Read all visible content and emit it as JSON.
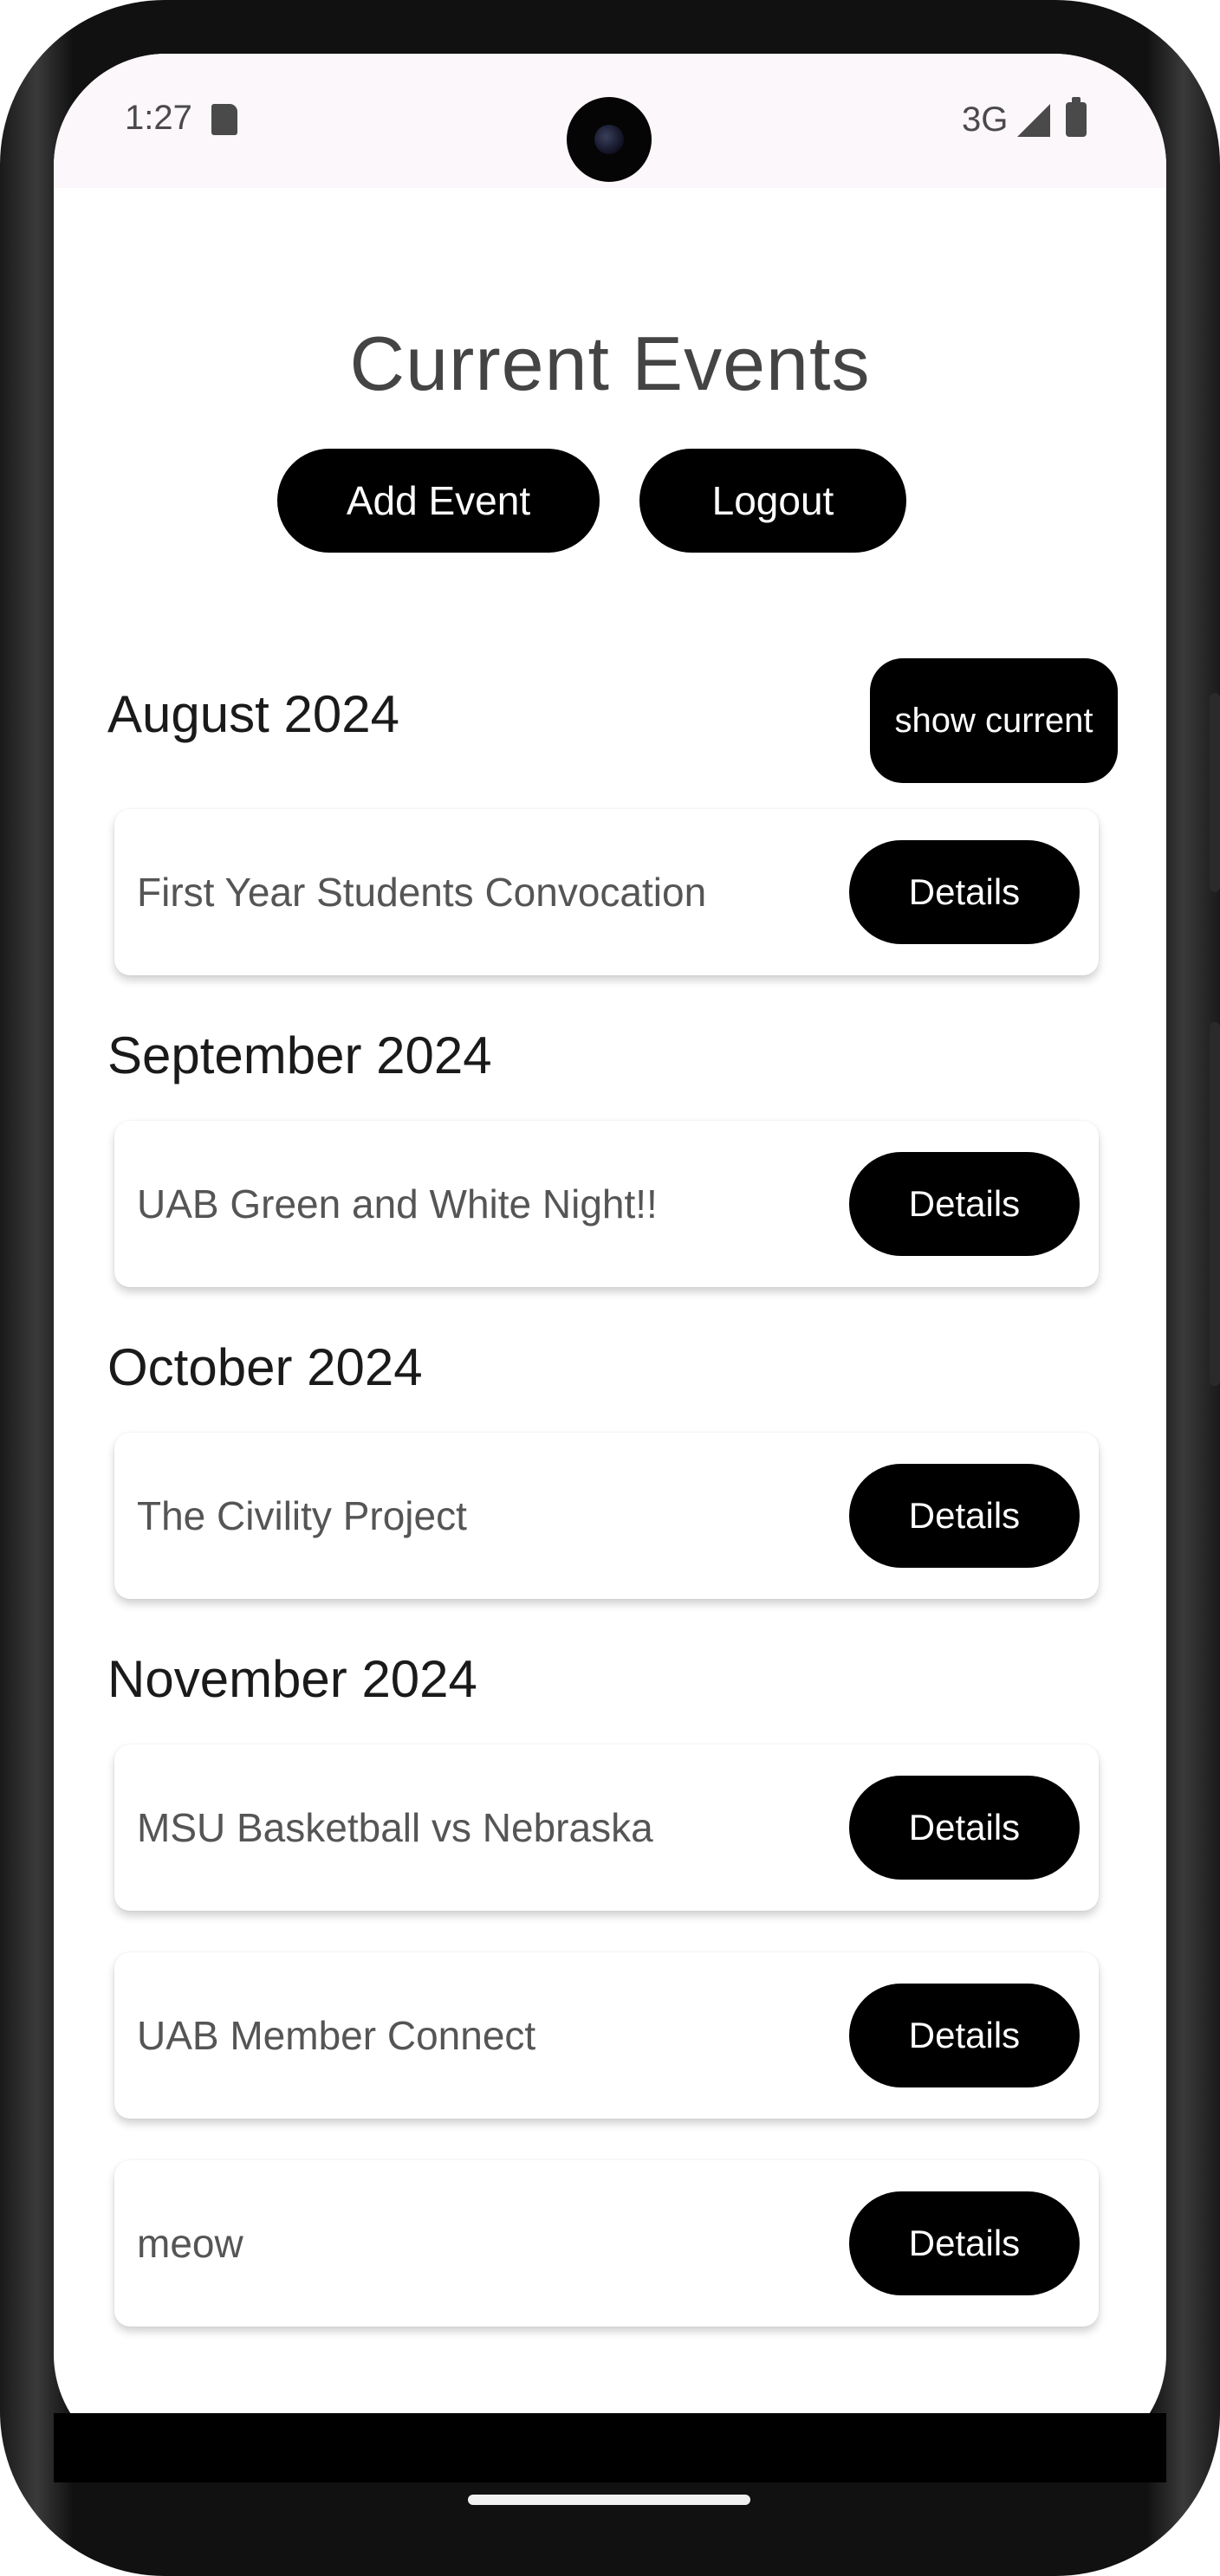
{
  "status_bar": {
    "time": "1:27",
    "network": "3G",
    "icons": [
      "sd-card-icon",
      "signal-icon",
      "battery-icon"
    ]
  },
  "header": {
    "title": "Current Events",
    "add_event_label": "Add Event",
    "logout_label": "Logout"
  },
  "show_current_label": "show current",
  "months": [
    {
      "label": "August 2024",
      "events": [
        {
          "title": "First Year Students Convocation",
          "button": "Details"
        }
      ]
    },
    {
      "label": "September 2024",
      "events": [
        {
          "title": "UAB Green and White Night!!",
          "button": "Details"
        }
      ]
    },
    {
      "label": "October 2024",
      "events": [
        {
          "title": "The Civility Project",
          "button": "Details"
        }
      ]
    },
    {
      "label": "November 2024",
      "events": [
        {
          "title": "MSU Basketball vs Nebraska",
          "button": "Details"
        },
        {
          "title": "UAB Member Connect",
          "button": "Details"
        },
        {
          "title": "meow",
          "button": "Details"
        }
      ]
    }
  ],
  "colors": {
    "button_bg": "#000000",
    "button_text": "#ffffff",
    "status_bar_bg": "#fcf7fb",
    "title_text": "#444444"
  }
}
